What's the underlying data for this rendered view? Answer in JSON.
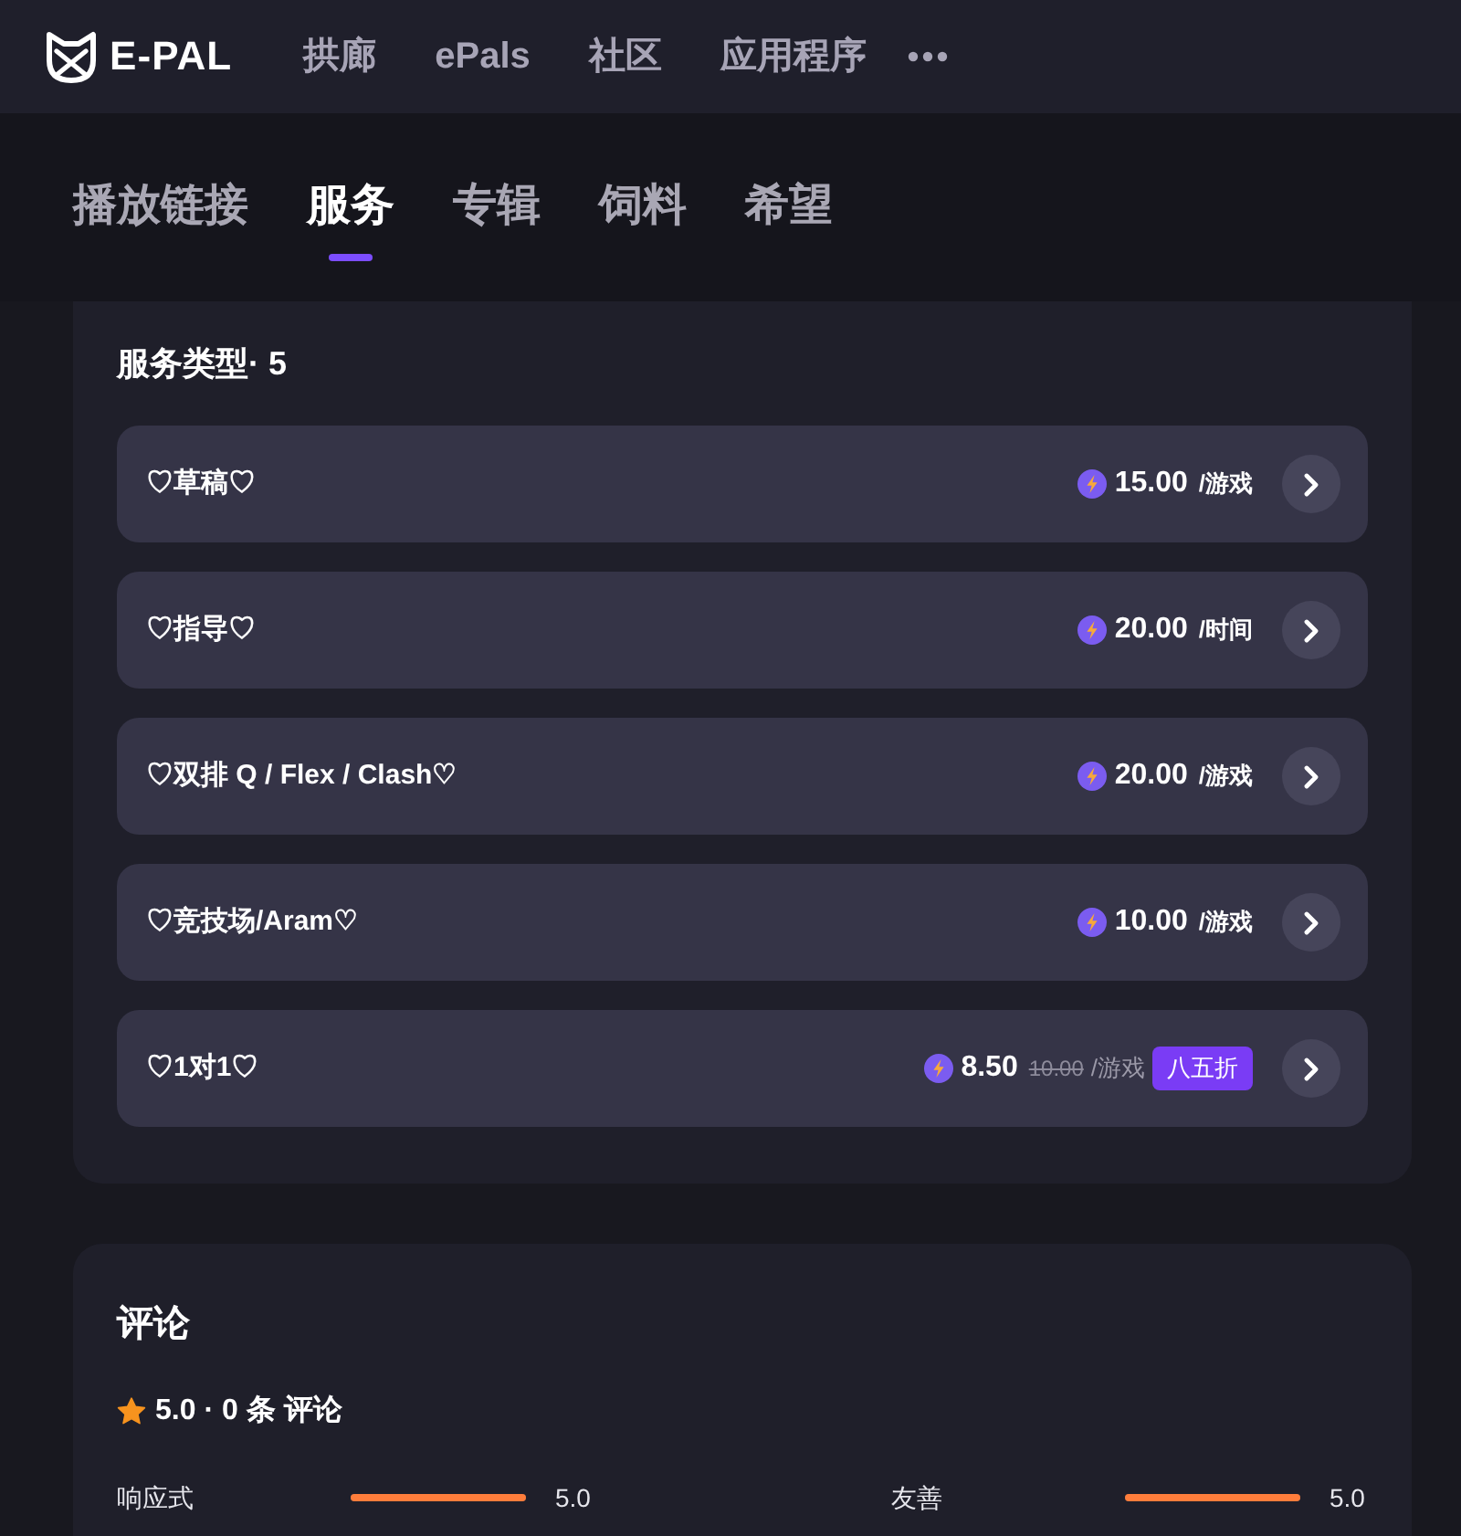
{
  "nav": {
    "logo": "E-PAL",
    "links": [
      "拱廊",
      "ePals",
      "社区",
      "应用程序"
    ]
  },
  "tabs": [
    {
      "label": "播放链接",
      "selected": false
    },
    {
      "label": "服务",
      "selected": true
    },
    {
      "label": "专辑",
      "selected": false
    },
    {
      "label": "饲料",
      "selected": false
    },
    {
      "label": "希望",
      "selected": false
    }
  ],
  "services": {
    "title": "服务类型· 5",
    "items": [
      {
        "kind": "standard",
        "name": "♡草稿♡",
        "price": "15.00",
        "unit": "/游戏"
      },
      {
        "kind": "standard",
        "name": "♡指导♡",
        "price": "20.00",
        "unit": "/时间"
      },
      {
        "kind": "standard",
        "name": "♡双排 Q / Flex / Clash♡",
        "price": "20.00",
        "unit": "/游戏"
      },
      {
        "kind": "standard",
        "name": "♡竞技场/Aram♡",
        "price": "10.00",
        "unit": "/游戏"
      },
      {
        "kind": "discounted",
        "name": "♡1对1♡",
        "price": "8.50",
        "original_price": "10.00",
        "unit": "/游戏",
        "badge": "八五折"
      }
    ]
  },
  "reviews": {
    "title": "评论",
    "summary": "5.0 · 0 条 评论",
    "ratings": [
      {
        "label": "响应式",
        "level": 1,
        "reading": "5.0"
      },
      {
        "label": "友善",
        "level": 1,
        "reading": "5.0"
      }
    ]
  }
}
